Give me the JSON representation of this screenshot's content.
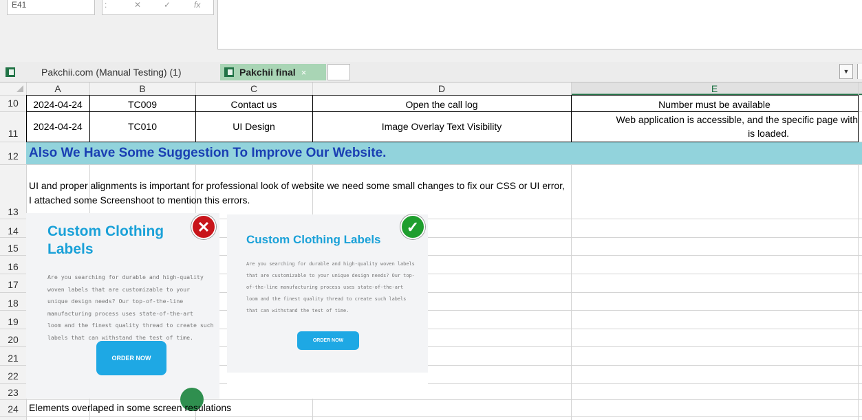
{
  "formula_bar": {
    "name_box": "E41",
    "colon": ":",
    "cancel": "✕",
    "enter": "✓",
    "fx": "fx"
  },
  "tabs": [
    {
      "label": "Pakchii.com (Manual Testing) (1)",
      "active": false
    },
    {
      "label": "Pakchii final",
      "active": true,
      "close": "×"
    }
  ],
  "dropdown_glyph": "▼",
  "columns": [
    "A",
    "B",
    "C",
    "D",
    "E"
  ],
  "rows": [
    {
      "num": "10",
      "date": "2024-04-24",
      "id": "TC009",
      "module": "Contact us",
      "scenario": "Open the call log",
      "expected": "Number must be available"
    },
    {
      "num": "11",
      "date": "2024-04-24",
      "id": "TC010",
      "module": "UI Design",
      "scenario": "Image Overlay Text Visibility",
      "expected_line1": "Web application is accessible, and the specific page with",
      "expected_line2": "is loaded."
    }
  ],
  "row_numbers": [
    "12",
    "13",
    "14",
    "15",
    "16",
    "17",
    "18",
    "19",
    "20",
    "21",
    "22",
    "23",
    "24"
  ],
  "section_title": "Also We Have Some Suggestion To Improve Our Website.",
  "note": "UI and proper alignments is important for professional look of website we need some small changes to fix our CSS or UI error, I attached some Screenshoot to mention this errors.",
  "caption": "Elements overlaped in some screen resulations",
  "screenshot_bad": {
    "title_line1": "Custom Clothing",
    "title_line2": "Labels",
    "body": [
      "Are you searching for durable and high-quality",
      "woven labels that are customizable to your",
      "unique design needs? Our top-of-the-line",
      "manufacturing process uses state-of-the-art",
      "loom and the finest quality thread to create such",
      "labels that can withstand the test of time."
    ],
    "button": "ORDER NOW",
    "badge": "✕",
    "badge_color": "#c8151b"
  },
  "screenshot_good": {
    "title": "Custom Clothing Labels",
    "body": [
      "Are you searching for durable and high-quality woven labels",
      "that are customizable to your unique design needs? Our top-",
      "of-the-line manufacturing process uses state-of-the-art",
      "loom and the finest quality thread to create such labels",
      "that can withstand the test of time."
    ],
    "button": "ORDER NOW",
    "badge": "✓",
    "badge_color": "#1f9e2e"
  },
  "colors": {
    "banner": "#92d3dc",
    "banner_text": "#1a3fb3",
    "active_tab": "#a9d5b5",
    "accent_blue": "#1ea8e4"
  }
}
